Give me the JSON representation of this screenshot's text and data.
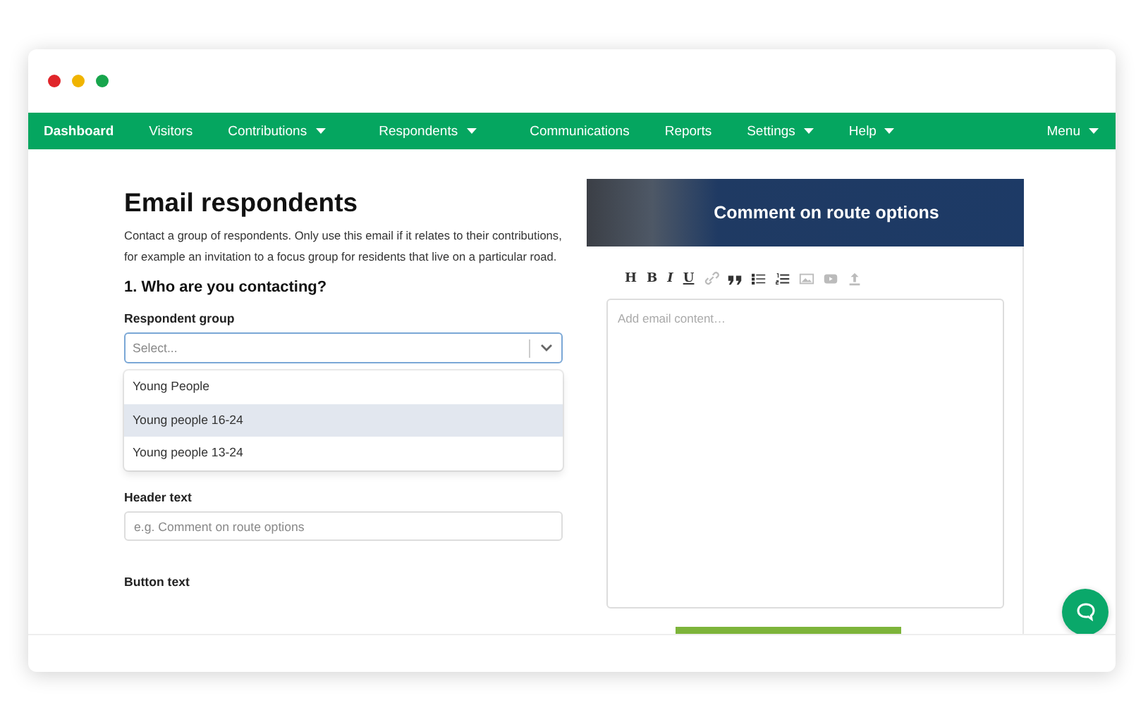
{
  "nav": {
    "items": [
      {
        "label": "Dashboard",
        "selected": true,
        "dropdown": false
      },
      {
        "label": "Visitors",
        "selected": false,
        "dropdown": false
      },
      {
        "label": "Contributions",
        "selected": false,
        "dropdown": true
      },
      {
        "label": "Respondents",
        "selected": false,
        "dropdown": true
      },
      {
        "label": "Communications",
        "selected": false,
        "dropdown": false
      },
      {
        "label": "Reports",
        "selected": false,
        "dropdown": false
      },
      {
        "label": "Settings",
        "selected": false,
        "dropdown": true
      },
      {
        "label": "Help",
        "selected": false,
        "dropdown": true
      }
    ],
    "menu": {
      "label": "Menu",
      "dropdown": true
    }
  },
  "form": {
    "title": "Email respondents",
    "intro": "Contact a group of respondents. Only use this email if it relates to their contributions, for example an invitation to a focus group for residents that live on a particular road.",
    "section_heading": "1. Who are you contacting?",
    "respondent_group": {
      "label": "Respondent group",
      "placeholder": "Select...",
      "expanded": true,
      "options": [
        {
          "label": "Young People",
          "selected": false
        },
        {
          "label": "Young people 16-24",
          "selected": true
        },
        {
          "label": "Young people 13-24",
          "selected": false
        }
      ]
    },
    "header_text": {
      "label": "Header text",
      "placeholder": "e.g. Comment on route options"
    },
    "button_text": {
      "label": "Button text"
    }
  },
  "preview": {
    "header_title": "Comment on route options",
    "toolbar": [
      {
        "kind": "char",
        "label": "H",
        "disabled": false
      },
      {
        "kind": "char",
        "label": "B",
        "disabled": false
      },
      {
        "kind": "char",
        "label": "I",
        "disabled": false
      },
      {
        "kind": "char",
        "label": "U",
        "disabled": false
      },
      {
        "kind": "link",
        "disabled": true
      },
      {
        "kind": "quote",
        "disabled": false
      },
      {
        "kind": "bullets",
        "disabled": false
      },
      {
        "kind": "numbers",
        "disabled": false
      },
      {
        "kind": "image",
        "disabled": true
      },
      {
        "kind": "video",
        "disabled": true
      },
      {
        "kind": "upload",
        "disabled": true
      }
    ],
    "editor": {
      "placeholder": "Add email content…"
    }
  }
}
